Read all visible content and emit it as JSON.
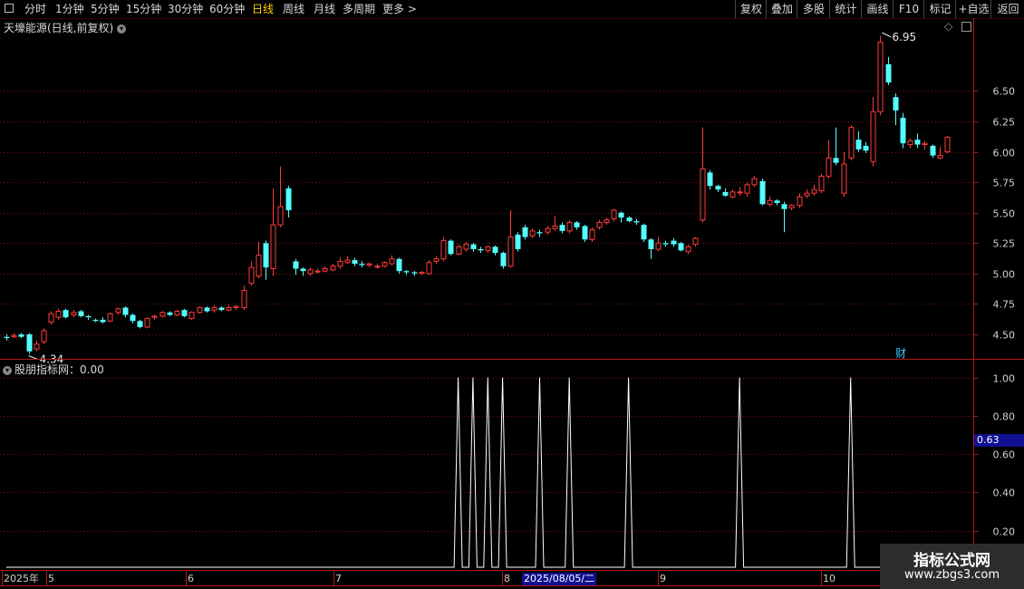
{
  "toolbar": {
    "left_items": [
      {
        "label": "分时",
        "active": false
      },
      {
        "label": "1分钟",
        "active": false
      },
      {
        "label": "5分钟",
        "active": false
      },
      {
        "label": "15分钟",
        "active": false
      },
      {
        "label": "30分钟",
        "active": false
      },
      {
        "label": "60分钟",
        "active": false
      },
      {
        "label": "日线",
        "active": true
      },
      {
        "label": "周线",
        "active": false
      },
      {
        "label": "月线",
        "active": false
      },
      {
        "label": "多周期",
        "active": false
      },
      {
        "label": "更多",
        "active": false
      }
    ],
    "right_items": [
      "复权",
      "叠加",
      "多股",
      "统计",
      "画线",
      "F10",
      "标记",
      "+自选",
      "返回"
    ]
  },
  "main_panel": {
    "title": "天壕能源(日线,前复权)",
    "finance_badge": "财"
  },
  "indicator_panel": {
    "title": "股朋指标网：0.00",
    "current_value_tag": "0.63"
  },
  "x_axis": {
    "labels": [
      "2025年",
      "5",
      "6",
      "7",
      "8",
      "9",
      "10"
    ],
    "cursor_date": "2025/08/05/二"
  },
  "watermark": {
    "line1": "指标公式网",
    "line2": "www.zbgs3.com"
  },
  "colors": {
    "up": "#ff3c3c",
    "down": "#54ffff",
    "grid": "#7a1010",
    "axis": "#b01818",
    "indicator": "#ffffff",
    "tag_bg": "#101090"
  },
  "chart_data": [
    {
      "type": "candlestick",
      "title": "天壕能源(日线,前复权)",
      "y_ticks": [
        "6.50",
        "6.25",
        "6.00",
        "5.75",
        "5.50",
        "5.25",
        "5.00",
        "4.75",
        "4.50"
      ],
      "ylim": [
        4.15,
        6.95
      ],
      "high_label": "6.95",
      "low_label": "4.34",
      "grid": true,
      "candles": [
        [
          4.48,
          4.47,
          4.5,
          4.45
        ],
        [
          4.48,
          4.49,
          4.51,
          4.47
        ],
        [
          4.5,
          4.48,
          4.51,
          4.47
        ],
        [
          4.5,
          4.36,
          4.51,
          4.34
        ],
        [
          4.38,
          4.42,
          4.45,
          4.36
        ],
        [
          4.44,
          4.53,
          4.55,
          4.42
        ],
        [
          4.6,
          4.67,
          4.69,
          4.58
        ],
        [
          4.64,
          4.69,
          4.71,
          4.62
        ],
        [
          4.7,
          4.64,
          4.71,
          4.63
        ],
        [
          4.66,
          4.68,
          4.7,
          4.64
        ],
        [
          4.69,
          4.65,
          4.7,
          4.64
        ],
        [
          4.65,
          4.64,
          4.66,
          4.62
        ],
        [
          4.62,
          4.61,
          4.63,
          4.6
        ],
        [
          4.62,
          4.6,
          4.64,
          4.59
        ],
        [
          4.61,
          4.67,
          4.68,
          4.6
        ],
        [
          4.68,
          4.71,
          4.72,
          4.66
        ],
        [
          4.72,
          4.66,
          4.73,
          4.64
        ],
        [
          4.66,
          4.61,
          4.67,
          4.59
        ],
        [
          4.61,
          4.56,
          4.62,
          4.55
        ],
        [
          4.56,
          4.63,
          4.64,
          4.55
        ],
        [
          4.64,
          4.65,
          4.66,
          4.62
        ],
        [
          4.65,
          4.68,
          4.69,
          4.64
        ],
        [
          4.68,
          4.66,
          4.69,
          4.65
        ],
        [
          4.66,
          4.69,
          4.7,
          4.65
        ],
        [
          4.7,
          4.65,
          4.71,
          4.64
        ],
        [
          4.63,
          4.68,
          4.69,
          4.62
        ],
        [
          4.68,
          4.72,
          4.73,
          4.67
        ],
        [
          4.72,
          4.69,
          4.73,
          4.68
        ],
        [
          4.7,
          4.72,
          4.74,
          4.68
        ],
        [
          4.72,
          4.7,
          4.73,
          4.69
        ],
        [
          4.7,
          4.72,
          4.74,
          4.69
        ],
        [
          4.72,
          4.73,
          4.74,
          4.7
        ],
        [
          4.72,
          4.86,
          4.9,
          4.7
        ],
        [
          4.92,
          5.05,
          5.1,
          4.9
        ],
        [
          4.98,
          5.15,
          5.26,
          4.96
        ],
        [
          5.25,
          5.05,
          5.27,
          4.95
        ],
        [
          5.04,
          5.4,
          5.7,
          4.98
        ],
        [
          5.4,
          5.55,
          5.88,
          5.38
        ],
        [
          5.7,
          5.52,
          5.72,
          5.46
        ],
        [
          5.1,
          5.04,
          5.12,
          4.99
        ],
        [
          5.04,
          5.02,
          5.05,
          4.98
        ],
        [
          5.0,
          5.03,
          5.05,
          4.98
        ],
        [
          5.02,
          5.02,
          5.04,
          5.0
        ],
        [
          5.02,
          5.04,
          5.06,
          5.01
        ],
        [
          5.03,
          5.06,
          5.08,
          5.02
        ],
        [
          5.06,
          5.1,
          5.13,
          5.04
        ],
        [
          5.09,
          5.11,
          5.14,
          5.08
        ],
        [
          5.11,
          5.08,
          5.13,
          5.06
        ],
        [
          5.08,
          5.07,
          5.1,
          5.05
        ],
        [
          5.07,
          5.08,
          5.09,
          5.05
        ],
        [
          5.06,
          5.06,
          5.08,
          5.04
        ],
        [
          5.06,
          5.09,
          5.1,
          5.05
        ],
        [
          5.08,
          5.12,
          5.15,
          5.07
        ],
        [
          5.12,
          5.02,
          5.13,
          5.0
        ],
        [
          5.02,
          5.01,
          5.03,
          4.99
        ],
        [
          5.01,
          5.0,
          5.02,
          4.98
        ],
        [
          5.0,
          5.01,
          5.02,
          4.99
        ],
        [
          5.0,
          5.09,
          5.11,
          4.99
        ],
        [
          5.1,
          5.12,
          5.14,
          5.08
        ],
        [
          5.12,
          5.27,
          5.3,
          5.1
        ],
        [
          5.27,
          5.16,
          5.28,
          5.15
        ],
        [
          5.16,
          5.22,
          5.24,
          5.15
        ],
        [
          5.2,
          5.24,
          5.26,
          5.18
        ],
        [
          5.24,
          5.2,
          5.25,
          5.18
        ],
        [
          5.2,
          5.19,
          5.22,
          5.17
        ],
        [
          5.19,
          5.22,
          5.23,
          5.17
        ],
        [
          5.22,
          5.17,
          5.23,
          5.15
        ],
        [
          5.17,
          5.06,
          5.18,
          5.04
        ],
        [
          5.06,
          5.3,
          5.52,
          5.05
        ],
        [
          5.32,
          5.2,
          5.34,
          5.18
        ],
        [
          5.38,
          5.3,
          5.4,
          5.28
        ],
        [
          5.31,
          5.35,
          5.37,
          5.29
        ],
        [
          5.34,
          5.33,
          5.36,
          5.3
        ],
        [
          5.34,
          5.37,
          5.39,
          5.32
        ],
        [
          5.37,
          5.39,
          5.47,
          5.35
        ],
        [
          5.4,
          5.35,
          5.42,
          5.33
        ],
        [
          5.35,
          5.42,
          5.44,
          5.33
        ],
        [
          5.42,
          5.38,
          5.43,
          5.36
        ],
        [
          5.39,
          5.28,
          5.4,
          5.26
        ],
        [
          5.28,
          5.36,
          5.38,
          5.26
        ],
        [
          5.38,
          5.42,
          5.44,
          5.36
        ],
        [
          5.42,
          5.44,
          5.46,
          5.4
        ],
        [
          5.45,
          5.52,
          5.53,
          5.43
        ],
        [
          5.5,
          5.46,
          5.51,
          5.42
        ],
        [
          5.46,
          5.43,
          5.47,
          5.42
        ],
        [
          5.43,
          5.42,
          5.45,
          5.4
        ],
        [
          5.4,
          5.28,
          5.41,
          5.26
        ],
        [
          5.28,
          5.2,
          5.29,
          5.12
        ],
        [
          5.2,
          5.25,
          5.3,
          5.18
        ],
        [
          5.25,
          5.24,
          5.27,
          5.22
        ],
        [
          5.27,
          5.24,
          5.29,
          5.22
        ],
        [
          5.25,
          5.19,
          5.26,
          5.18
        ],
        [
          5.18,
          5.22,
          5.24,
          5.16
        ],
        [
          5.24,
          5.29,
          5.3,
          5.22
        ],
        [
          5.44,
          5.86,
          6.2,
          5.42
        ],
        [
          5.83,
          5.72,
          5.85,
          5.69
        ],
        [
          5.72,
          5.69,
          5.73,
          5.67
        ],
        [
          5.67,
          5.64,
          5.7,
          5.63
        ],
        [
          5.63,
          5.67,
          5.69,
          5.62
        ],
        [
          5.67,
          5.67,
          5.71,
          5.64
        ],
        [
          5.66,
          5.73,
          5.75,
          5.63
        ],
        [
          5.73,
          5.78,
          5.8,
          5.71
        ],
        [
          5.76,
          5.57,
          5.78,
          5.56
        ],
        [
          5.57,
          5.6,
          5.63,
          5.55
        ],
        [
          5.6,
          5.58,
          5.61,
          5.56
        ],
        [
          5.57,
          5.53,
          5.59,
          5.34
        ],
        [
          5.54,
          5.56,
          5.57,
          5.52
        ],
        [
          5.56,
          5.63,
          5.66,
          5.54
        ],
        [
          5.64,
          5.66,
          5.69,
          5.62
        ],
        [
          5.66,
          5.69,
          5.73,
          5.64
        ],
        [
          5.68,
          5.8,
          5.82,
          5.66
        ],
        [
          5.8,
          5.95,
          6.1,
          5.78
        ],
        [
          5.95,
          5.91,
          6.2,
          5.89
        ],
        [
          5.66,
          5.9,
          6.0,
          5.63
        ],
        [
          5.95,
          6.2,
          6.22,
          5.93
        ],
        [
          6.1,
          6.02,
          6.17,
          6.0
        ],
        [
          6.05,
          6.01,
          6.08,
          5.99
        ],
        [
          5.92,
          6.33,
          6.45,
          5.88
        ],
        [
          6.33,
          6.9,
          6.95,
          6.3
        ],
        [
          6.72,
          6.57,
          6.78,
          6.55
        ],
        [
          6.45,
          6.34,
          6.48,
          6.22
        ],
        [
          6.28,
          6.07,
          6.32,
          6.03
        ],
        [
          6.06,
          6.09,
          6.11,
          6.03
        ],
        [
          6.1,
          6.06,
          6.15,
          6.03
        ],
        [
          6.06,
          6.07,
          6.09,
          6.02
        ],
        [
          6.05,
          5.97,
          6.06,
          5.95
        ],
        [
          5.95,
          5.97,
          6.04,
          5.94
        ],
        [
          6.0,
          6.12,
          6.13,
          5.99
        ]
      ]
    },
    {
      "type": "line",
      "title": "股朋指标网",
      "y_ticks": [
        "1.00",
        "0.80",
        "0.60",
        "0.40",
        "0.20"
      ],
      "ylim": [
        0,
        1.05
      ],
      "grid": true,
      "spike_value": 1.0,
      "spike_indices": [
        61,
        63,
        65,
        67,
        72,
        76,
        84,
        99,
        114
      ]
    }
  ]
}
